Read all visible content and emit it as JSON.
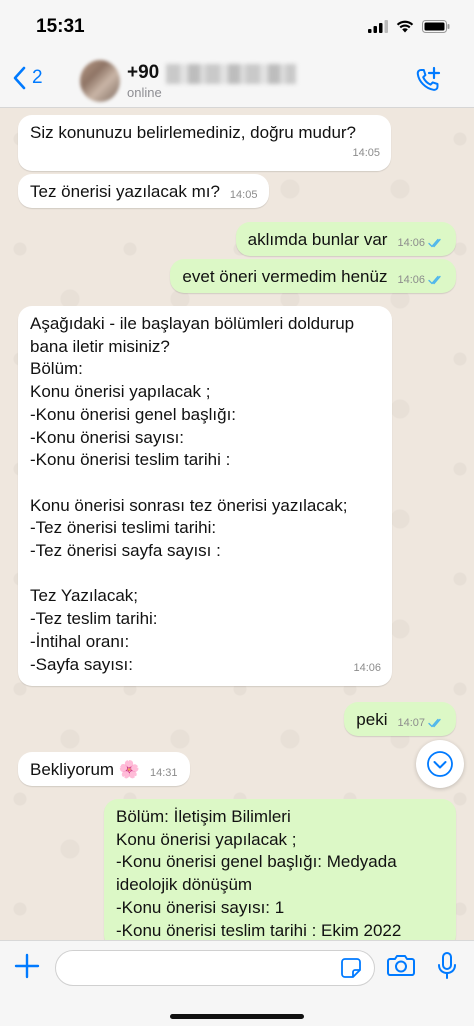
{
  "status_bar": {
    "time": "15:31"
  },
  "header": {
    "back_count": "2",
    "contact_name": "+90",
    "contact_status": "online"
  },
  "messages": [
    {
      "dir": "in",
      "text": "Siz konunuzu belirlemediniz, doğru mudur?",
      "time": "14:05"
    },
    {
      "dir": "in",
      "text": "Tez önerisi yazılacak mı?",
      "time": "14:05"
    },
    {
      "dir": "out",
      "text": "aklımda bunlar var",
      "time": "14:06"
    },
    {
      "dir": "out",
      "text": "evet öneri vermedim henüz",
      "time": "14:06"
    },
    {
      "dir": "in",
      "text": "Aşağıdaki - ile başlayan bölümleri doldurup\nbana iletir misiniz?\nBölüm:\nKonu önerisi yapılacak ;\n-Konu önerisi genel başlığı:\n-Konu önerisi sayısı:\n-Konu önerisi teslim tarihi :\n\nKonu önerisi sonrası tez önerisi yazılacak;\n-Tez önerisi teslimi tarihi:\n-Tez önerisi sayfa sayısı :\n\nTez Yazılacak;\n-Tez teslim tarihi:\n-İntihal oranı:\n-Sayfa sayısı:",
      "time": "14:06"
    },
    {
      "dir": "out",
      "text": "peki",
      "time": "14:07"
    },
    {
      "dir": "in",
      "text": "Bekliyorum 🌸",
      "time": "14:31"
    },
    {
      "dir": "out",
      "text": "Bölüm: İletişim Bilimleri\nKonu önerisi yapılacak ;\n-Konu önerisi genel başlığı: Medyada\nideolojik dönüşüm\n-Konu önerisi sayısı: 1\n-Konu önerisi teslim tarihi : Ekim 2022",
      "time": ""
    }
  ],
  "icons": {
    "back": "chevron-left-icon",
    "call": "add-call-icon",
    "read": "double-check-icon",
    "scroll": "chevron-down-icon",
    "plus": "plus-icon",
    "sticker": "sticker-icon",
    "camera": "camera-icon",
    "mic": "mic-icon"
  },
  "colors": {
    "accent": "#007aff",
    "incoming_bubble": "#ffffff",
    "outgoing_bubble": "#dcf8c6",
    "read_ticks": "#4fb6ec",
    "chat_background": "#efe7de"
  }
}
